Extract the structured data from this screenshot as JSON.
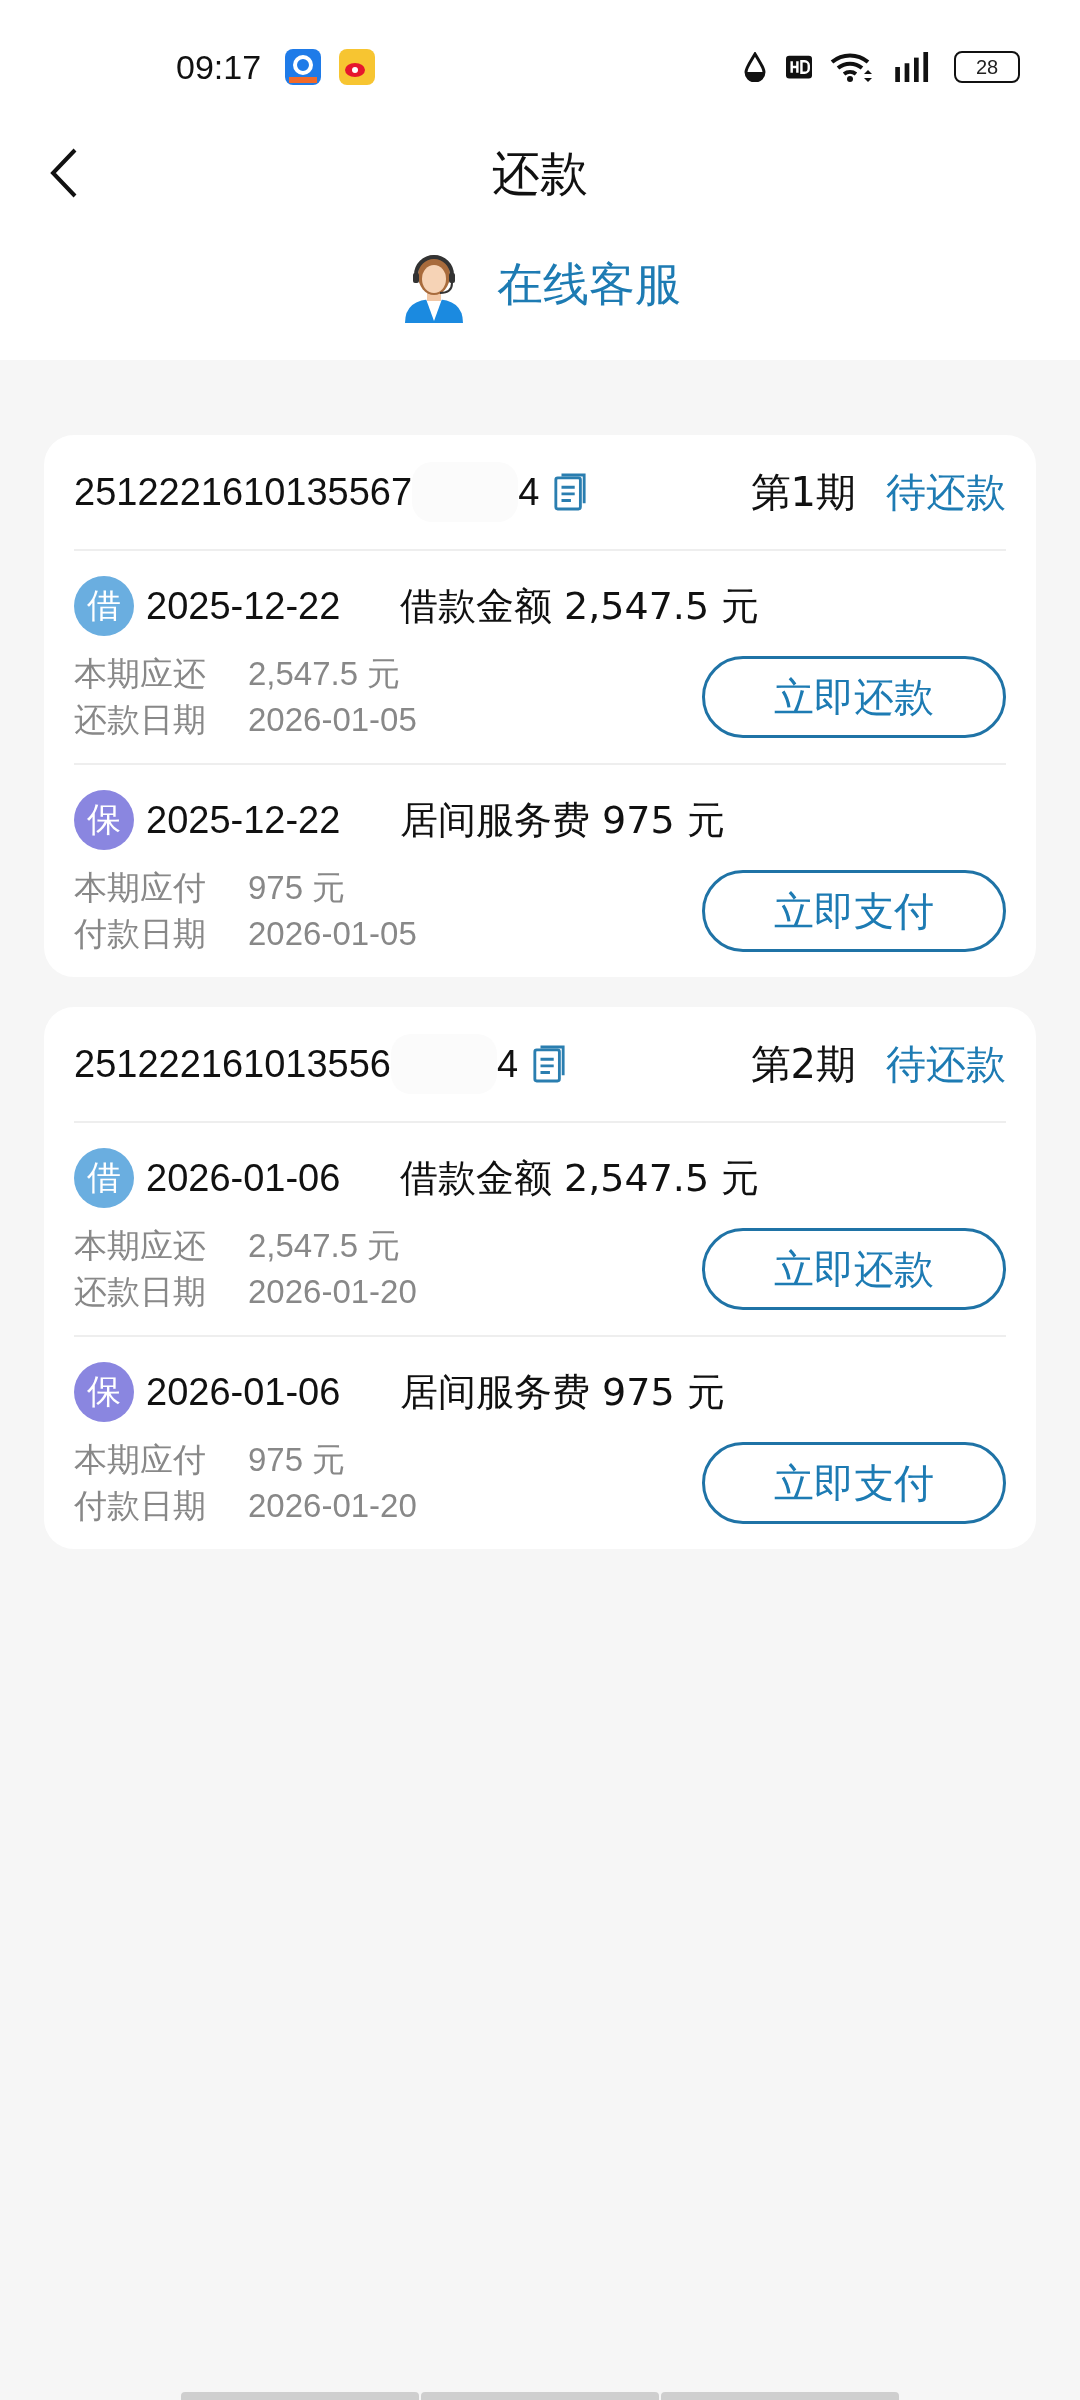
{
  "status_bar": {
    "time": "09:17",
    "battery": "28"
  },
  "header": {
    "title": "还款"
  },
  "support": {
    "label": "在线客服"
  },
  "cards": [
    {
      "order_prefix": "2512221610135567",
      "order_suffix": "4",
      "period": "第1期",
      "status": "待还款",
      "items": [
        {
          "kind": "loan",
          "badge": "借",
          "date": "2025-12-22",
          "summary": "借款金额 2,547.5 元",
          "rows": [
            {
              "label": "本期应还",
              "value": "2,547.5 元"
            },
            {
              "label": "还款日期",
              "value": "2026-01-05"
            }
          ],
          "button": "立即还款"
        },
        {
          "kind": "fee",
          "badge": "保",
          "date": "2025-12-22",
          "summary": "居间服务费 975 元",
          "rows": [
            {
              "label": "本期应付",
              "value": "975 元"
            },
            {
              "label": "付款日期",
              "value": "2026-01-05"
            }
          ],
          "button": "立即支付"
        }
      ]
    },
    {
      "order_prefix": "251222161013556",
      "order_suffix": "4",
      "period": "第2期",
      "status": "待还款",
      "items": [
        {
          "kind": "loan",
          "badge": "借",
          "date": "2026-01-06",
          "summary": "借款金额 2,547.5 元",
          "rows": [
            {
              "label": "本期应还",
              "value": "2,547.5 元"
            },
            {
              "label": "还款日期",
              "value": "2026-01-20"
            }
          ],
          "button": "立即还款"
        },
        {
          "kind": "fee",
          "badge": "保",
          "date": "2026-01-06",
          "summary": "居间服务费 975 元",
          "rows": [
            {
              "label": "本期应付",
              "value": "975 元"
            },
            {
              "label": "付款日期",
              "value": "2026-01-20"
            }
          ],
          "button": "立即支付"
        }
      ]
    }
  ]
}
